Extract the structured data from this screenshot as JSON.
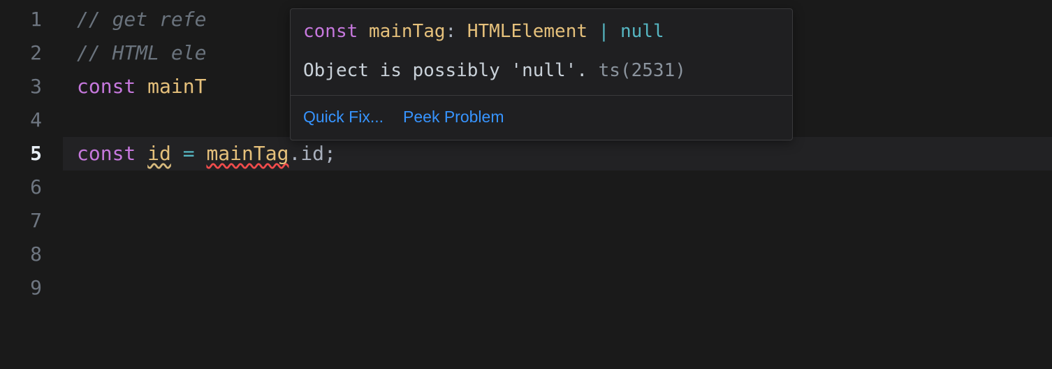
{
  "gutter": {
    "lines": [
      "1",
      "2",
      "3",
      "4",
      "5",
      "6",
      "7",
      "8",
      "9"
    ],
    "activeIndex": 4
  },
  "code": {
    "line1": {
      "comment": "// get refe"
    },
    "line2": {
      "comment": "// HTML ele"
    },
    "line3": {
      "kw": "const",
      "sp": " ",
      "var": "mainT"
    },
    "line5": {
      "kw": "const",
      "sp1": " ",
      "var": "id",
      "sp2": " ",
      "eq": "=",
      "sp3": " ",
      "obj": "mainTag",
      "dot": ".",
      "prop": "id",
      "semi": ";"
    }
  },
  "hover": {
    "sig": {
      "kw": "const",
      "sp1": " ",
      "var": "mainTag",
      "colon": ":",
      "sp2": " ",
      "type": "HTMLElement",
      "sp3": " ",
      "pipe": "|",
      "sp4": " ",
      "null": "null"
    },
    "message": "Object is possibly 'null'.",
    "sep": " ",
    "errcode": "ts(2531)",
    "actions": {
      "quickfix": "Quick Fix...",
      "peek": "Peek Problem"
    }
  }
}
